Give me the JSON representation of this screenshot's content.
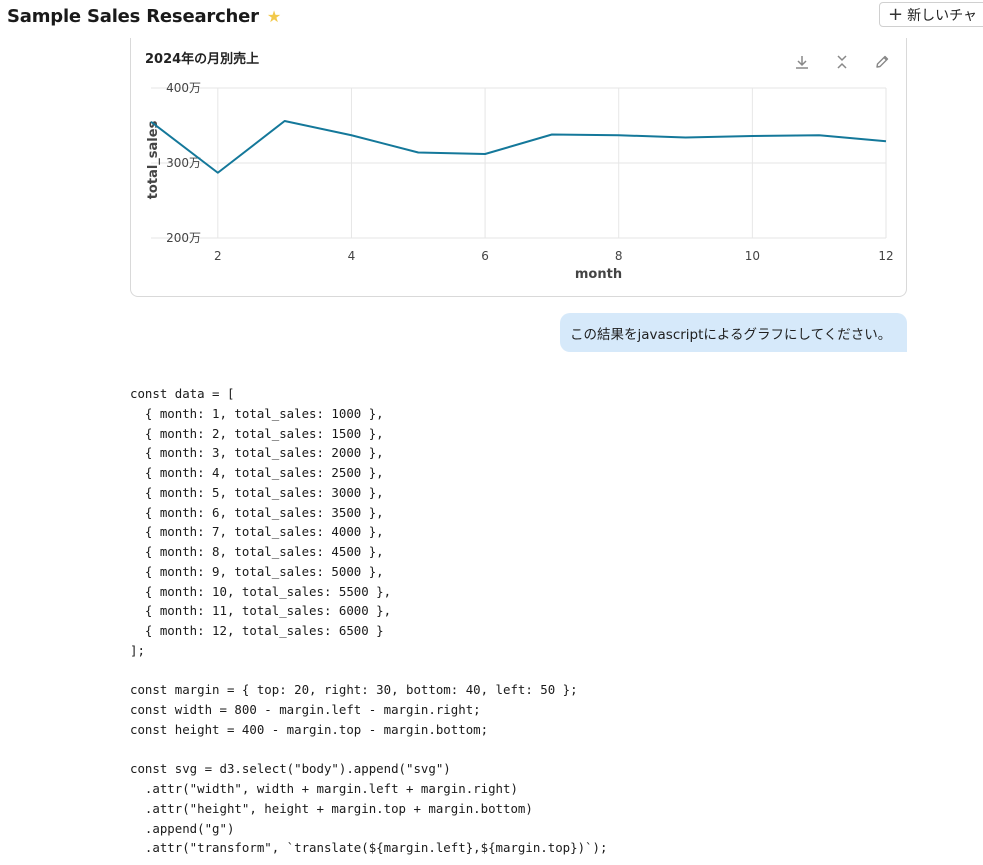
{
  "header": {
    "title": "Sample Sales Researcher",
    "star_icon": "★",
    "new_chat_label": "新しいチャ",
    "plus_icon": "+"
  },
  "chart_card": {
    "tools": [
      "download-icon",
      "collapse-icon",
      "edit-icon"
    ]
  },
  "chart_data": {
    "type": "line",
    "title": "2024年の月別売上",
    "xlabel": "month",
    "ylabel": "total_sales",
    "x": [
      1,
      2,
      3,
      4,
      5,
      6,
      7,
      8,
      9,
      10,
      11,
      12
    ],
    "values": [
      3550000,
      2870000,
      3560000,
      3370000,
      3140000,
      3120000,
      3380000,
      3370000,
      3340000,
      3360000,
      3370000,
      3290000
    ],
    "xlim": [
      1,
      12
    ],
    "ylim": [
      2000000,
      4000000
    ],
    "xticks": [
      2,
      4,
      6,
      8,
      10,
      12
    ],
    "yticks": [
      2000000,
      3000000,
      4000000
    ],
    "ytick_labels": [
      "200万",
      "300万",
      "400万"
    ],
    "grid": true,
    "line_color": "#14789a"
  },
  "message": {
    "user_text": "この結果をjavascriptによるグラフにしてください。"
  },
  "code": {
    "lines": [
      "const data = [",
      "  { month: 1, total_sales: 1000 },",
      "  { month: 2, total_sales: 1500 },",
      "  { month: 3, total_sales: 2000 },",
      "  { month: 4, total_sales: 2500 },",
      "  { month: 5, total_sales: 3000 },",
      "  { month: 6, total_sales: 3500 },",
      "  { month: 7, total_sales: 4000 },",
      "  { month: 8, total_sales: 4500 },",
      "  { month: 9, total_sales: 5000 },",
      "  { month: 10, total_sales: 5500 },",
      "  { month: 11, total_sales: 6000 },",
      "  { month: 12, total_sales: 6500 }",
      "];",
      "",
      "const margin = { top: 20, right: 30, bottom: 40, left: 50 };",
      "const width = 800 - margin.left - margin.right;",
      "const height = 400 - margin.top - margin.bottom;",
      "",
      "const svg = d3.select(\"body\").append(\"svg\")",
      "  .attr(\"width\", width + margin.left + margin.right)",
      "  .attr(\"height\", height + margin.top + margin.bottom)",
      "  .append(\"g\")",
      "  .attr(\"transform\", `translate(${margin.left},${margin.top})`);"
    ]
  }
}
